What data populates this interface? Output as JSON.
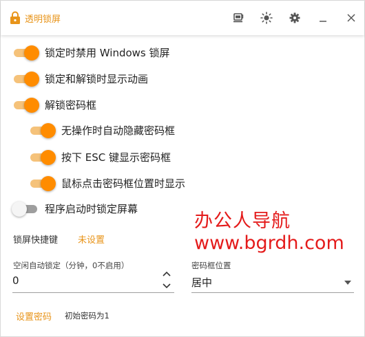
{
  "titlebar": {
    "title": "透明锁屏",
    "buttons": [
      {
        "name": "coffee-icon"
      },
      {
        "name": "theme-sun-icon"
      },
      {
        "name": "settings-gear-icon"
      },
      {
        "name": "minimize-icon"
      },
      {
        "name": "close-icon"
      }
    ]
  },
  "options": [
    {
      "label": "锁定时禁用 Windows 锁屏",
      "on": true,
      "indent": false
    },
    {
      "label": "锁定和解锁时显示动画",
      "on": true,
      "indent": false
    },
    {
      "label": "解锁密码框",
      "on": true,
      "indent": false
    },
    {
      "label": "无操作时自动隐藏密码框",
      "on": true,
      "indent": true
    },
    {
      "label": "按下 ESC 键显示密码框",
      "on": true,
      "indent": true
    },
    {
      "label": "鼠标点击密码框位置时显示",
      "on": true,
      "indent": true
    },
    {
      "label": "程序启动时锁定屏幕",
      "on": false,
      "indent": false
    }
  ],
  "hotkey": {
    "label": "锁屏快捷键",
    "value": "未设置"
  },
  "watermark": {
    "line1": "办公人导航",
    "line2": "www.bgrdh.com"
  },
  "idle_lock": {
    "caption": "空闲自动锁定（分钟，0不启用）",
    "value": "0"
  },
  "box_position": {
    "caption": "密码框位置",
    "value": "居中"
  },
  "password": {
    "link": "设置密码",
    "hint": "初始密码为1"
  },
  "colors": {
    "accent": "#ff8c00",
    "accent_text": "#e8941a",
    "watermark": "#e41b1b"
  }
}
